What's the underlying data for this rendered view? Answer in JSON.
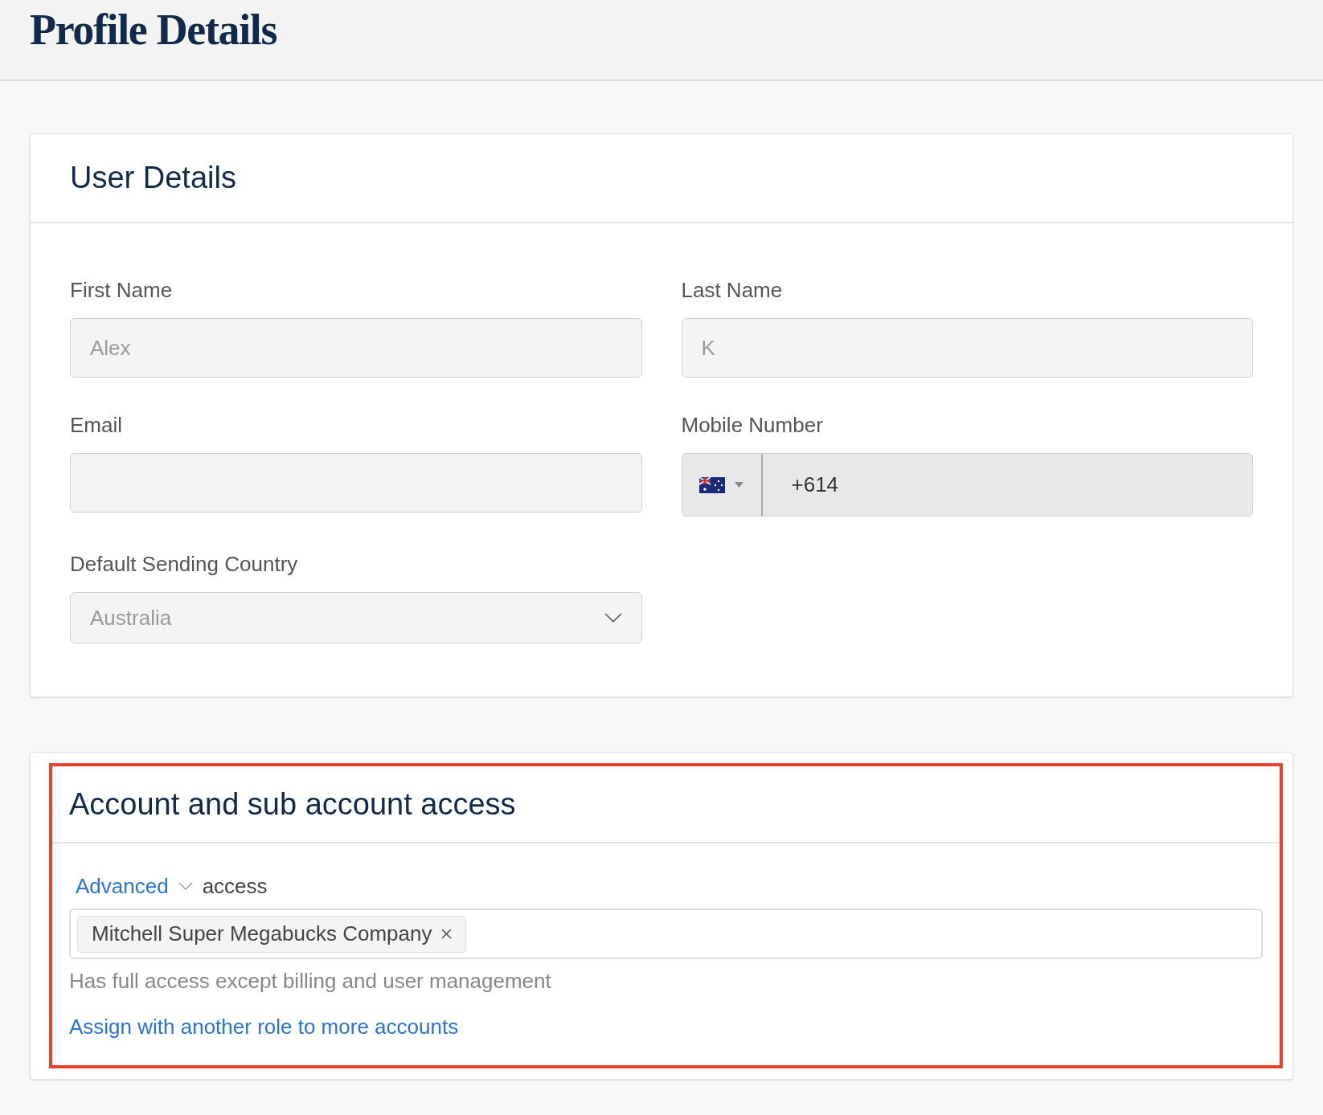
{
  "page": {
    "title": "Profile Details"
  },
  "user_details": {
    "title": "User Details",
    "fields": [
      {
        "kind": "text",
        "label": "First Name",
        "value": "Alex",
        "disabled": true
      },
      {
        "kind": "text",
        "label": "Last Name",
        "value": "K",
        "disabled": true
      },
      {
        "kind": "text",
        "label": "Email"
      },
      {
        "kind": "phone",
        "label": "Mobile Number",
        "value": "+614"
      },
      {
        "kind": "select",
        "label": "Default Sending Country",
        "value": "Australia",
        "disabled": true
      }
    ]
  },
  "access": {
    "title": "Account and sub account access",
    "highlighted": true,
    "role": "Advanced",
    "role_suffix": "access",
    "tags": [
      "Mitchell Super Megabucks Company"
    ],
    "description": "Has full access except billing and user management",
    "link": "Assign with another role to more accounts"
  }
}
